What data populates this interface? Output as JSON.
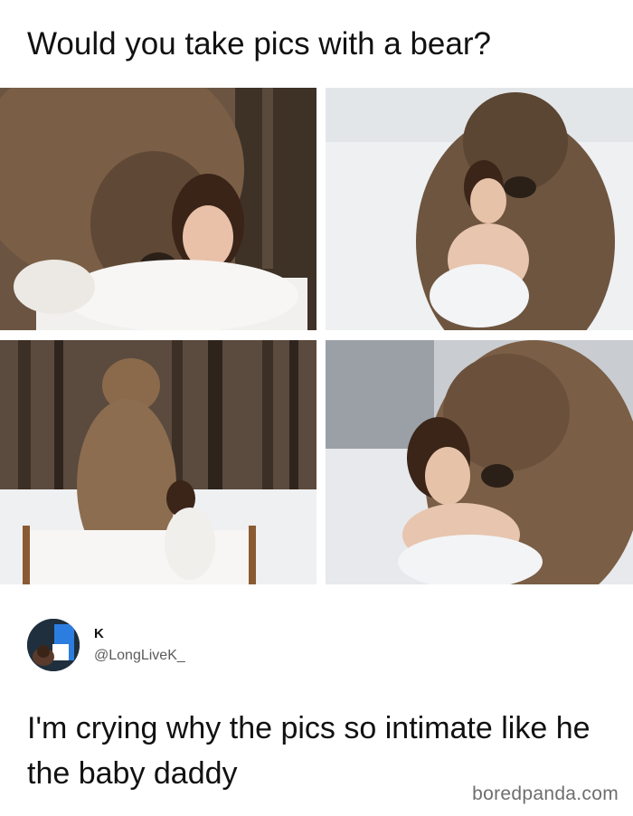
{
  "title": "Would you take pics with a bear?",
  "photos": [
    {
      "id": "photo-1"
    },
    {
      "id": "photo-2"
    },
    {
      "id": "photo-3"
    },
    {
      "id": "photo-4"
    }
  ],
  "tweet": {
    "name": "K",
    "handle": "@LongLiveK_",
    "text": "I'm crying why the pics so intimate like he the baby daddy"
  },
  "watermark": "boredpanda.com"
}
